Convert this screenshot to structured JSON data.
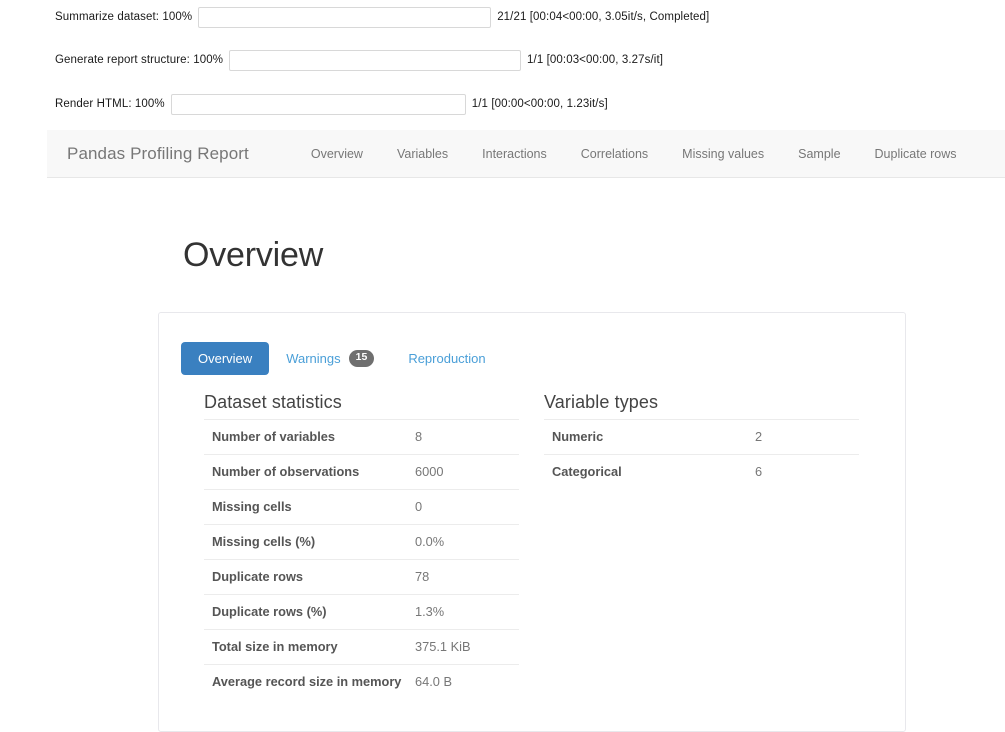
{
  "progress": {
    "bars": [
      {
        "label": "Summarize dataset: 100%",
        "percent": 100,
        "stats": "21/21 [00:04<00:00, 3.05it/s, Completed]"
      },
      {
        "label": "Generate report structure: 100%",
        "percent": 100,
        "stats": "1/1 [00:03<00:00, 3.27s/it]"
      },
      {
        "label": "Render HTML: 100%",
        "percent": 100,
        "stats": "1/1 [00:00<00:00, 1.23it/s]"
      }
    ],
    "fill_color": "#4caf50"
  },
  "navbar": {
    "brand": "Pandas Profiling Report",
    "links": [
      {
        "label": "Overview"
      },
      {
        "label": "Variables"
      },
      {
        "label": "Interactions"
      },
      {
        "label": "Correlations"
      },
      {
        "label": "Missing values"
      },
      {
        "label": "Sample"
      },
      {
        "label": "Duplicate rows"
      }
    ]
  },
  "main": {
    "title": "Overview",
    "tabs": [
      {
        "label": "Overview",
        "active": true,
        "badge": null
      },
      {
        "label": "Warnings",
        "active": false,
        "badge": "15"
      },
      {
        "label": "Reproduction",
        "active": false,
        "badge": null
      }
    ],
    "active_tab_color": "#3a80c0",
    "link_color": "#4a9fd8",
    "badge_color": "#6f6f6f",
    "dataset_statistics": {
      "heading": "Dataset statistics",
      "rows": [
        {
          "label": "Number of variables",
          "value": "8"
        },
        {
          "label": "Number of observations",
          "value": "6000"
        },
        {
          "label": "Missing cells",
          "value": "0"
        },
        {
          "label": "Missing cells (%)",
          "value": "0.0%"
        },
        {
          "label": "Duplicate rows",
          "value": "78"
        },
        {
          "label": "Duplicate rows (%)",
          "value": "1.3%"
        },
        {
          "label": "Total size in memory",
          "value": "375.1 KiB"
        },
        {
          "label": "Average record size in memory",
          "value": "64.0 B"
        }
      ]
    },
    "variable_types": {
      "heading": "Variable types",
      "rows": [
        {
          "label": "Numeric",
          "value": "2"
        },
        {
          "label": "Categorical",
          "value": "6"
        }
      ]
    }
  }
}
